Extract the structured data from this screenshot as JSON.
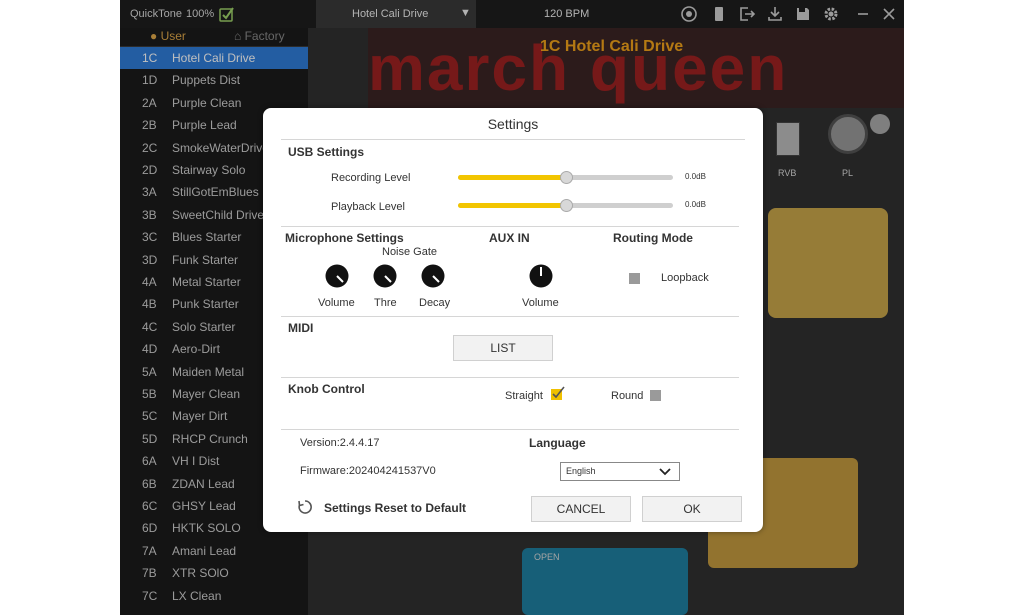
{
  "topbar": {
    "brand": "QuickTone",
    "battery": "100%",
    "preset_name": "Hotel Cali Drive",
    "bpm": "120 BPM"
  },
  "sidebar": {
    "tab_user": "User",
    "tab_factory": "Factory",
    "items": [
      {
        "id": "1C",
        "name": "Hotel Cali Drive"
      },
      {
        "id": "1D",
        "name": "Puppets Dist"
      },
      {
        "id": "2A",
        "name": "Purple Clean"
      },
      {
        "id": "2B",
        "name": "Purple Lead"
      },
      {
        "id": "2C",
        "name": "SmokeWaterDrive"
      },
      {
        "id": "2D",
        "name": "Stairway Solo"
      },
      {
        "id": "3A",
        "name": "StillGotEmBlues"
      },
      {
        "id": "3B",
        "name": "SweetChild Drive"
      },
      {
        "id": "3C",
        "name": "Blues Starter"
      },
      {
        "id": "3D",
        "name": "Funk Starter"
      },
      {
        "id": "4A",
        "name": "Metal Starter"
      },
      {
        "id": "4B",
        "name": "Punk Starter"
      },
      {
        "id": "4C",
        "name": "Solo Starter"
      },
      {
        "id": "4D",
        "name": "Aero-Dirt"
      },
      {
        "id": "5A",
        "name": "Maiden Metal"
      },
      {
        "id": "5B",
        "name": "Mayer Clean"
      },
      {
        "id": "5C",
        "name": "Mayer Dirt"
      },
      {
        "id": "5D",
        "name": "RHCP Crunch"
      },
      {
        "id": "6A",
        "name": "VH I Dist"
      },
      {
        "id": "6B",
        "name": "ZDAN   Lead"
      },
      {
        "id": "6C",
        "name": "GHSY   Lead"
      },
      {
        "id": "6D",
        "name": "HKTK  SOLO"
      },
      {
        "id": "7A",
        "name": "Amani   Lead"
      },
      {
        "id": "7B",
        "name": "XTR  SOlO"
      },
      {
        "id": "7C",
        "name": "LX  Clean"
      }
    ]
  },
  "background": {
    "banner": "march queen",
    "preset_title": "1C Hotel Cali Drive",
    "rvb_label": "RVB",
    "pl_label": "PL",
    "pedal_label": "OPEN"
  },
  "settings": {
    "title": "Settings",
    "usb_heading": "USB Settings",
    "recording_label": "Recording Level",
    "recording_value": "0.0dB",
    "recording_level": 0.5,
    "playback_label": "Playback Level",
    "playback_value": "0.0dB",
    "playback_level": 0.5,
    "mic_heading": "Microphone Settings",
    "noise_gate_label": "Noise Gate",
    "mic_volume_label": "Volume",
    "thre_label": "Thre",
    "decay_label": "Decay",
    "aux_heading": "AUX IN",
    "aux_volume_label": "Volume",
    "routing_heading": "Routing Mode",
    "loopback_label": "Loopback",
    "midi_heading": "MIDI",
    "list_button": "LIST",
    "knob_heading": "Knob Control",
    "straight_label": "Straight",
    "round_label": "Round",
    "version": "Version:2.4.4.17",
    "firmware": "Firmware:202404241537V0",
    "language_heading": "Language",
    "language_value": "English",
    "reset_label": "Settings Reset to Default",
    "cancel_button": "CANCEL",
    "ok_button": "OK"
  },
  "colors": {
    "accent_selected": "#2f7cd9",
    "slider_fill": "#f2c500",
    "user_tab": "#e0a84a"
  }
}
